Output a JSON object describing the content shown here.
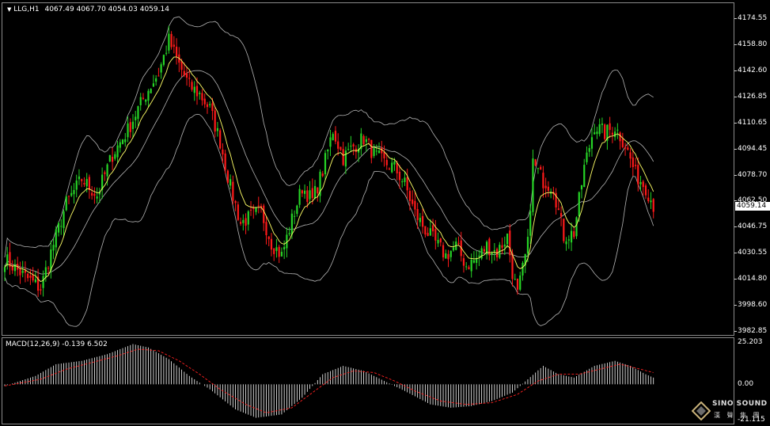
{
  "header": {
    "symbol": "LLG,H1",
    "ohlc": "4067.49 4067.70 4054.03 4059.14"
  },
  "price_axis": {
    "ticks": [
      "4174.55",
      "4158.80",
      "4142.60",
      "4126.85",
      "4110.65",
      "4094.45",
      "4078.70",
      "4062.50",
      "4046.75",
      "4030.55",
      "4014.80",
      "3998.60",
      "3982.85"
    ],
    "current_price": "4059.14"
  },
  "macd": {
    "label": "MACD(12,26,9) -0.139 6.502",
    "ticks": [
      "25.203",
      "0.00",
      "-21.115"
    ]
  },
  "logo": {
    "name": "SINO SOUND",
    "sub": "漢 聲 集 團"
  },
  "colors": {
    "bull": "#26d426",
    "bear": "#ff1a1a",
    "ma": "#ffff66",
    "band": "#b4b4b4",
    "signal": "#ff2020",
    "histogram": "#ffffff"
  },
  "chart_data": {
    "type": "candlestick",
    "ylim": [
      3982.85,
      4174.55
    ],
    "close_key_points": [
      [
        0,
        4026
      ],
      [
        8,
        4015
      ],
      [
        14,
        4008
      ],
      [
        18,
        4030
      ],
      [
        24,
        4060
      ],
      [
        30,
        4075
      ],
      [
        36,
        4065
      ],
      [
        42,
        4090
      ],
      [
        48,
        4105
      ],
      [
        52,
        4118
      ],
      [
        56,
        4130
      ],
      [
        60,
        4140
      ],
      [
        64,
        4160
      ],
      [
        68,
        4145
      ],
      [
        72,
        4132
      ],
      [
        76,
        4127
      ],
      [
        80,
        4118
      ],
      [
        84,
        4098
      ],
      [
        88,
        4070
      ],
      [
        92,
        4048
      ],
      [
        96,
        4052
      ],
      [
        100,
        4055
      ],
      [
        104,
        4036
      ],
      [
        108,
        4028
      ],
      [
        112,
        4050
      ],
      [
        116,
        4070
      ],
      [
        120,
        4062
      ],
      [
        124,
        4080
      ],
      [
        128,
        4105
      ],
      [
        132,
        4088
      ],
      [
        136,
        4095
      ],
      [
        140,
        4100
      ],
      [
        144,
        4090
      ],
      [
        148,
        4085
      ],
      [
        152,
        4082
      ],
      [
        156,
        4072
      ],
      [
        160,
        4054
      ],
      [
        164,
        4044
      ],
      [
        168,
        4036
      ],
      [
        172,
        4028
      ],
      [
        176,
        4034
      ],
      [
        180,
        4022
      ],
      [
        184,
        4026
      ],
      [
        188,
        4034
      ],
      [
        192,
        4030
      ],
      [
        196,
        4040
      ],
      [
        198,
        4018
      ],
      [
        200,
        4004
      ],
      [
        204,
        4035
      ],
      [
        206,
        4085
      ],
      [
        210,
        4074
      ],
      [
        214,
        4070
      ],
      [
        218,
        4040
      ],
      [
        222,
        4042
      ],
      [
        226,
        4082
      ],
      [
        230,
        4108
      ],
      [
        234,
        4103
      ],
      [
        238,
        4107
      ],
      [
        242,
        4096
      ],
      [
        246,
        4078
      ],
      [
        250,
        4070
      ],
      [
        253,
        4059
      ]
    ],
    "macd_key_points": [
      [
        0,
        -1
      ],
      [
        12,
        5
      ],
      [
        20,
        12
      ],
      [
        30,
        14
      ],
      [
        40,
        18
      ],
      [
        50,
        24
      ],
      [
        56,
        22
      ],
      [
        64,
        15
      ],
      [
        72,
        5
      ],
      [
        80,
        -3
      ],
      [
        90,
        -15
      ],
      [
        98,
        -20
      ],
      [
        108,
        -18
      ],
      [
        116,
        -8
      ],
      [
        124,
        6
      ],
      [
        132,
        11
      ],
      [
        140,
        8
      ],
      [
        148,
        2
      ],
      [
        156,
        -4
      ],
      [
        166,
        -12
      ],
      [
        174,
        -14
      ],
      [
        182,
        -13
      ],
      [
        190,
        -10
      ],
      [
        198,
        -5
      ],
      [
        204,
        3
      ],
      [
        210,
        11
      ],
      [
        216,
        6
      ],
      [
        222,
        4
      ],
      [
        230,
        11
      ],
      [
        238,
        14
      ],
      [
        244,
        11
      ],
      [
        250,
        6
      ],
      [
        253,
        4
      ]
    ],
    "signal_key_points": [
      [
        0,
        -1
      ],
      [
        14,
        3
      ],
      [
        24,
        9
      ],
      [
        34,
        13
      ],
      [
        44,
        17
      ],
      [
        52,
        21
      ],
      [
        60,
        20
      ],
      [
        68,
        14
      ],
      [
        76,
        6
      ],
      [
        84,
        -3
      ],
      [
        94,
        -12
      ],
      [
        102,
        -17
      ],
      [
        112,
        -14
      ],
      [
        120,
        -5
      ],
      [
        128,
        4
      ],
      [
        136,
        8
      ],
      [
        144,
        7
      ],
      [
        152,
        2
      ],
      [
        160,
        -4
      ],
      [
        170,
        -10
      ],
      [
        180,
        -12
      ],
      [
        190,
        -11
      ],
      [
        200,
        -6
      ],
      [
        208,
        2
      ],
      [
        216,
        6
      ],
      [
        224,
        6
      ],
      [
        232,
        9
      ],
      [
        240,
        12
      ],
      [
        248,
        9
      ],
      [
        253,
        7
      ]
    ],
    "macd_ylim": [
      -21.115,
      25.203
    ]
  }
}
